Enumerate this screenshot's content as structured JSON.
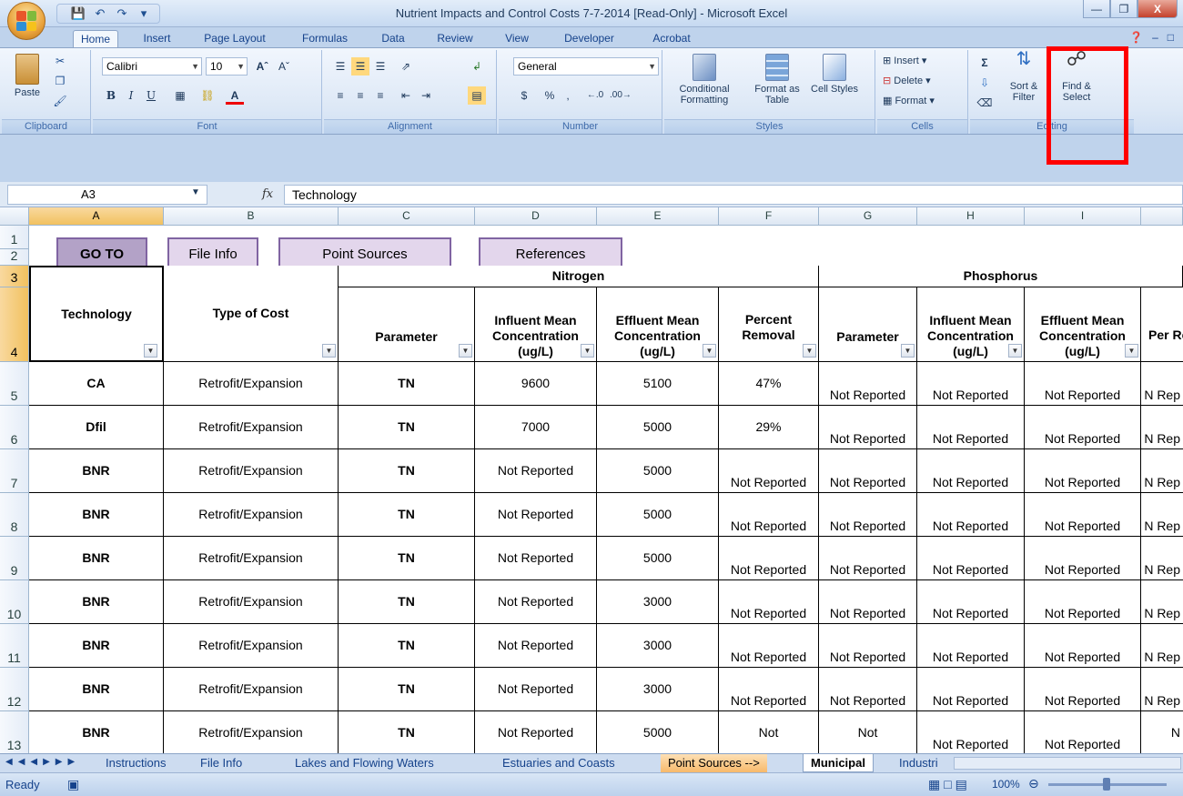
{
  "window": {
    "title": "Nutrient Impacts and Control Costs 7-7-2014  [Read-Only] - Microsoft Excel",
    "minimize": "—",
    "maximize": "❐",
    "close": "X"
  },
  "ribbon_tabs": [
    "Home",
    "Insert",
    "Page Layout",
    "Formulas",
    "Data",
    "Review",
    "View",
    "Developer",
    "Acrobat"
  ],
  "ribbon": {
    "clipboard": {
      "paste": "Paste",
      "label": "Clipboard"
    },
    "font": {
      "name": "Calibri",
      "size": "10",
      "label": "Font"
    },
    "alignment": {
      "label": "Alignment"
    },
    "number": {
      "format": "General",
      "currency": "$",
      "percent": "%",
      "comma": ",",
      "label": "Number"
    },
    "styles": {
      "conditional": "Conditional Formatting",
      "format_table": "Format as Table",
      "cell_styles": "Cell Styles",
      "label": "Styles"
    },
    "cells": {
      "insert": "Insert",
      "delete": "Delete",
      "format": "Format",
      "label": "Cells"
    },
    "editing": {
      "sort": "Sort & Filter",
      "find": "Find & Select",
      "label": "Editing"
    }
  },
  "formula_bar": {
    "name_box": "A3",
    "fx": "fx",
    "value": "Technology"
  },
  "columns": [
    "A",
    "B",
    "C",
    "D",
    "E",
    "F",
    "G",
    "H",
    "I"
  ],
  "nav_buttons": {
    "goto": "GO TO",
    "file_info": "File Info",
    "point_sources": "Point Sources",
    "references": "References"
  },
  "table": {
    "group_nitrogen": "Nitrogen",
    "group_phosphorus": "Phosphorus",
    "headers": {
      "technology": "Technology",
      "type_of_cost": "Type of Cost",
      "n_parameter": "Parameter",
      "n_influent": "Influent Mean Concentration (ug/L)",
      "n_effluent": "Effluent Mean Concentration (ug/L)",
      "n_percent": "Percent Removal",
      "p_parameter": "Parameter",
      "p_influent": "Influent Mean Concentration (ug/L)",
      "p_effluent": "Effluent Mean Concentration (ug/L)",
      "p_percent": "Per Rem"
    },
    "rows": [
      [
        "CA",
        "Retrofit/Expansion",
        "TN",
        "9600",
        "5100",
        "47%",
        "Not Reported",
        "Not Reported",
        "Not Reported",
        "N Rep"
      ],
      [
        "Dfil",
        "Retrofit/Expansion",
        "TN",
        "7000",
        "5000",
        "29%",
        "Not Reported",
        "Not Reported",
        "Not Reported",
        "N Rep"
      ],
      [
        "BNR",
        "Retrofit/Expansion",
        "TN",
        "Not Reported",
        "5000",
        "Not Reported",
        "Not Reported",
        "Not Reported",
        "Not Reported",
        "N Rep"
      ],
      [
        "BNR",
        "Retrofit/Expansion",
        "TN",
        "Not Reported",
        "5000",
        "Not Reported",
        "Not Reported",
        "Not Reported",
        "Not Reported",
        "N Rep"
      ],
      [
        "BNR",
        "Retrofit/Expansion",
        "TN",
        "Not Reported",
        "5000",
        "Not Reported",
        "Not Reported",
        "Not Reported",
        "Not Reported",
        "N Rep"
      ],
      [
        "BNR",
        "Retrofit/Expansion",
        "TN",
        "Not Reported",
        "3000",
        "Not Reported",
        "Not Reported",
        "Not Reported",
        "Not Reported",
        "N Rep"
      ],
      [
        "BNR",
        "Retrofit/Expansion",
        "TN",
        "Not Reported",
        "3000",
        "Not Reported",
        "Not Reported",
        "Not Reported",
        "Not Reported",
        "N Rep"
      ],
      [
        "BNR",
        "Retrofit/Expansion",
        "TN",
        "Not Reported",
        "3000",
        "Not Reported",
        "Not Reported",
        "Not Reported",
        "Not Reported",
        "N Rep"
      ],
      [
        "BNR",
        "Retrofit/Expansion",
        "TN",
        "Not Reported",
        "5000",
        "Not",
        "Not",
        "Not Reported",
        "Not Reported",
        "N"
      ]
    ]
  },
  "row_numbers": [
    "1",
    "2",
    "3",
    "4",
    "5",
    "6",
    "7",
    "8",
    "9",
    "10",
    "11",
    "12",
    "13"
  ],
  "sheet_tabs": [
    "Instructions",
    "File Info",
    "Lakes and Flowing Waters",
    "Estuaries and Coasts",
    "Point Sources -->",
    "Municipal",
    "Industri"
  ],
  "status": {
    "ready": "Ready",
    "zoom": "100%"
  }
}
